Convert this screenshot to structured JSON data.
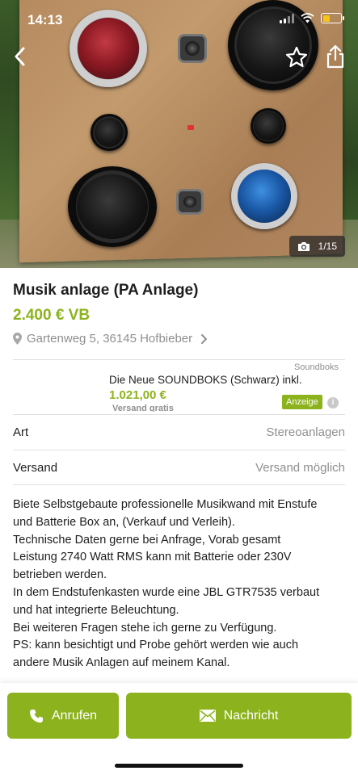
{
  "status_bar": {
    "time": "14:13"
  },
  "photo": {
    "counter": "1/15"
  },
  "listing": {
    "title": "Musik anlage (PA Anlage)",
    "price": "2.400 € VB",
    "location": "Gartenweg 5, 36145 Hofbieber"
  },
  "ad": {
    "brand": "Soundboks",
    "title": "Die Neue SOUNDBOKS (Schwarz) inkl.",
    "price": "1.021,00 €",
    "shipping": "Versand gratis",
    "badge": "Anzeige"
  },
  "attributes": [
    {
      "key": "Art",
      "value": "Stereoanlagen"
    },
    {
      "key": "Versand",
      "value": "Versand möglich"
    }
  ],
  "description": [
    "Biete Selbstgebaute professionelle Musikwand mit Enstufe",
    "und Batterie Box an, (Verkauf und Verleih).",
    "Technische Daten gerne bei Anfrage, Vorab gesamt",
    "Leistung 2740 Watt RMS kann mit Batterie oder 230V",
    "betrieben werden.",
    "In dem Endstufenkasten wurde eine JBL GTR7535 verbaut",
    "und hat integrierte Beleuchtung.",
    "Bei weiteren Fragen stehe ich gerne zu Verfügung.",
    "PS: kann besichtigt und Probe gehört werden wie auch",
    "andere Musik Anlagen auf meinem Kanal."
  ],
  "actions": {
    "call_label": "Anrufen",
    "message_label": "Nachricht"
  },
  "colors": {
    "accent": "#8cb31d",
    "muted": "#8f8f8f",
    "text": "#1e1e1e"
  }
}
